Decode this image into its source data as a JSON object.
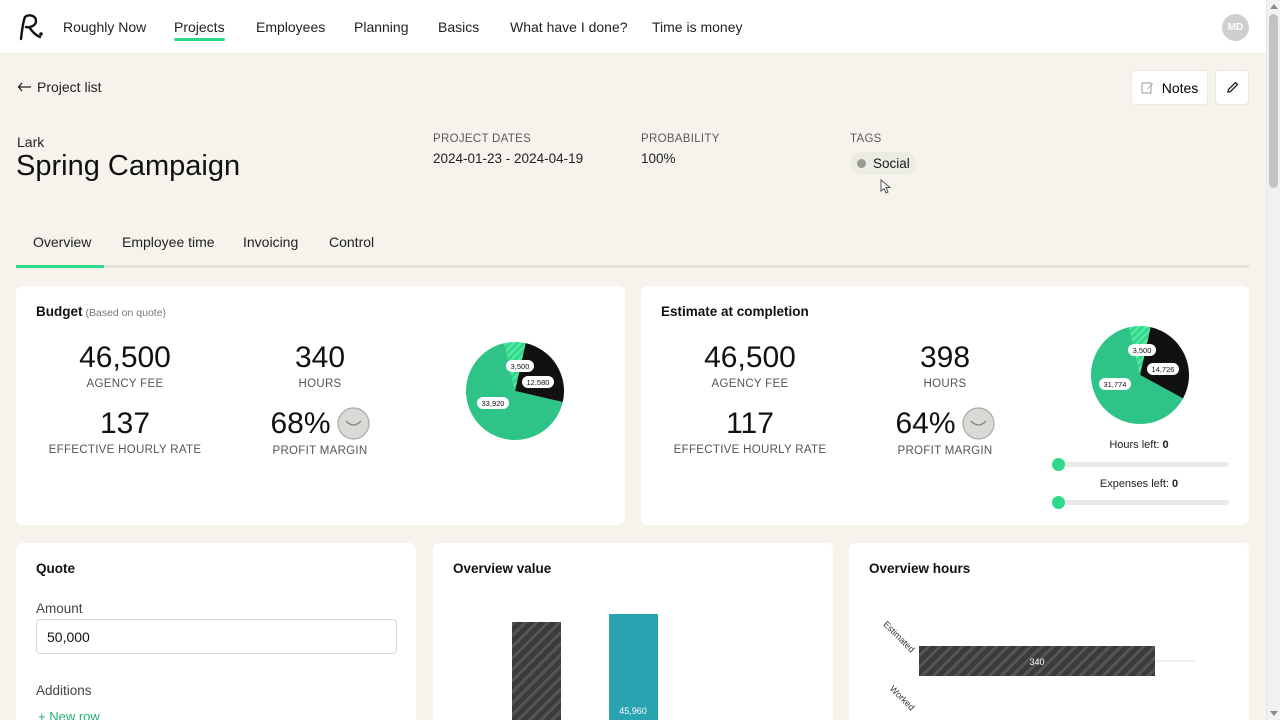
{
  "nav": {
    "items": [
      {
        "label": "Roughly Now"
      },
      {
        "label": "Projects"
      },
      {
        "label": "Employees"
      },
      {
        "label": "Planning"
      },
      {
        "label": "Basics"
      },
      {
        "label": "What have I done?"
      },
      {
        "label": "Time is money"
      }
    ],
    "active": "Projects",
    "avatar": "MD"
  },
  "back_link": "Project list",
  "notes_label": "Notes",
  "project": {
    "client": "Lark",
    "title": "Spring Campaign",
    "dates_label": "PROJECT DATES",
    "dates": "2024-01-23 - 2024-04-19",
    "probability_label": "PROBABILITY",
    "probability": "100%",
    "tags_label": "TAGS",
    "tags": [
      "Social"
    ]
  },
  "tabs": [
    "Overview",
    "Employee time",
    "Invoicing",
    "Control"
  ],
  "active_tab": "Overview",
  "budget": {
    "title": "Budget",
    "subtitle": "(Based on quote)",
    "agency_fee": "46,500",
    "agency_fee_label": "AGENCY FEE",
    "hours": "340",
    "hours_label": "HOURS",
    "rate": "137",
    "rate_label": "EFFECTIVE HOURLY RATE",
    "margin": "68%",
    "margin_label": "PROFIT MARGIN",
    "pie_labels": [
      "3,500",
      "12,580",
      "33,920"
    ]
  },
  "estimate": {
    "title": "Estimate at completion",
    "agency_fee": "46,500",
    "agency_fee_label": "AGENCY FEE",
    "hours": "398",
    "hours_label": "HOURS",
    "rate": "117",
    "rate_label": "EFFECTIVE HOURLY RATE",
    "margin": "64%",
    "margin_label": "PROFIT MARGIN",
    "pie_labels": [
      "3,500",
      "14,726",
      "31,774"
    ],
    "hours_left_label": "Hours left:",
    "hours_left": "0",
    "expenses_left_label": "Expenses left:",
    "expenses_left": "0"
  },
  "quote": {
    "title": "Quote",
    "amount_label": "Amount",
    "amount_value": "50,000",
    "additions_label": "Additions",
    "new_row": "New row"
  },
  "overview_value": {
    "title": "Overview value",
    "bar_label": "45,960"
  },
  "overview_hours": {
    "title": "Overview hours",
    "row_labels": [
      "Estimated",
      "Worked"
    ],
    "estimated_value": "340"
  },
  "chart_data": [
    {
      "type": "pie",
      "title": "Budget",
      "categories": [
        "3,500",
        "12,580",
        "33,920"
      ],
      "values": [
        3500,
        12580,
        33920
      ],
      "colors": [
        "#2fd98a",
        "#111111",
        "#2ec487"
      ]
    },
    {
      "type": "pie",
      "title": "Estimate at completion",
      "categories": [
        "3,500",
        "14,726",
        "31,774"
      ],
      "values": [
        3500,
        14726,
        31774
      ],
      "colors": [
        "#2fd98a",
        "#111111",
        "#2ec487"
      ]
    }
  ],
  "colors": {
    "accent": "#2fd98a",
    "pie_main": "#2ec487",
    "pie_dark": "#111111",
    "bar_teal": "#2aa3b0",
    "bar_dark": "#3b3b3b",
    "background": "#f5f3ec"
  }
}
